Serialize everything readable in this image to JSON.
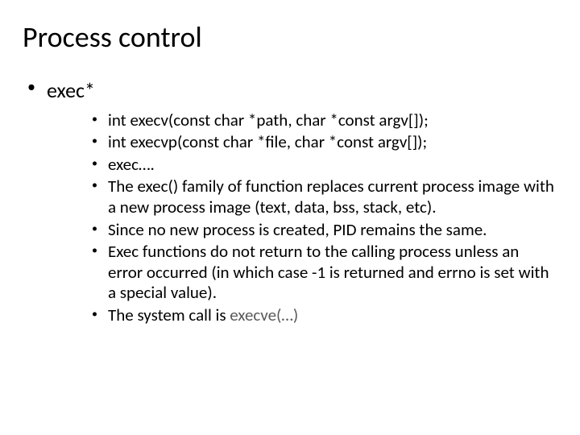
{
  "title": "Process control",
  "outer": {
    "label": "exec*",
    "items": [
      "int execv(const char *path, char *const argv[]);",
      "int execvp(const char *file, char *const argv[]);",
      "exec….",
      "The exec() family of function replaces current process image with a new process image (text, data, bss, stack, etc).",
      "Since no new process is created, PID remains the same.",
      "Exec functions do not return to the calling process unless an error occurred (in which case -1 is returned and errno is set with a special value).",
      "The system call is "
    ],
    "syscall": "execve(…)"
  }
}
